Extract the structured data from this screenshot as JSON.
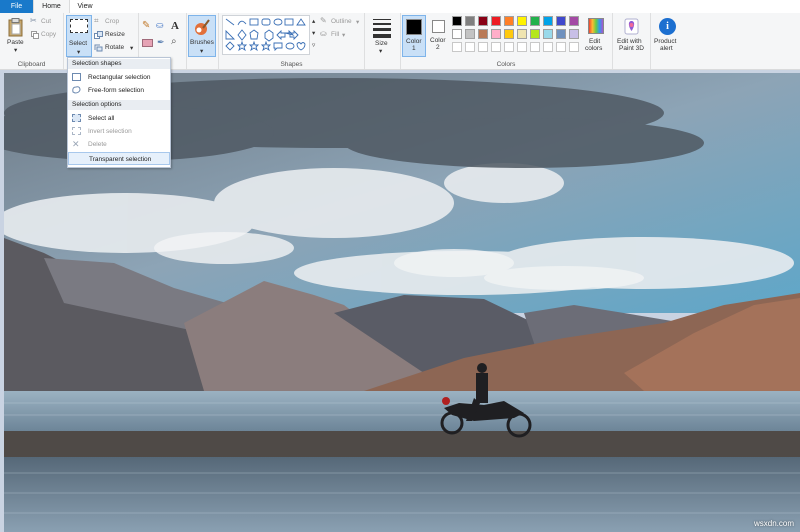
{
  "tabs": {
    "file": "File",
    "home": "Home",
    "view": "View"
  },
  "clipboard": {
    "paste": "Paste",
    "cut": "Cut",
    "copy": "Copy",
    "group": "Clipboard"
  },
  "image": {
    "select": "Select",
    "crop": "Crop",
    "resize": "Resize",
    "rotate": "Rotate"
  },
  "tools": {
    "text_icon_glyph": "A"
  },
  "brushes": {
    "label": "Brushes"
  },
  "shapes": {
    "group": "Shapes",
    "outline": "Outline",
    "fill": "Fill"
  },
  "size": {
    "label": "Size"
  },
  "colors": {
    "color1_line1": "Color",
    "color1_line2": "1",
    "color2_line1": "Color",
    "color2_line2": "2",
    "group": "Colors",
    "edit_line1": "Edit",
    "edit_line2": "colors",
    "color1_value": "#000000",
    "color2_value": "#ffffff",
    "palette_row1": [
      "#000000",
      "#7f7f7f",
      "#880015",
      "#ed1c24",
      "#ff7f27",
      "#fff200",
      "#22b14c",
      "#00a2e8",
      "#3f48cc",
      "#a349a4"
    ],
    "palette_row2": [
      "#ffffff",
      "#c3c3c3",
      "#b97a57",
      "#ffaec9",
      "#ffc90e",
      "#efe4b0",
      "#b5e61d",
      "#99d9ea",
      "#7092be",
      "#c8bfe7"
    ]
  },
  "paint3d": {
    "line1": "Edit with",
    "line2": "Paint 3D"
  },
  "alert": {
    "line1": "Product",
    "line2": "alert"
  },
  "select_menu": {
    "shapes_heading": "Selection shapes",
    "rectangular": "Rectangular selection",
    "freeform": "Free-form selection",
    "options_heading": "Selection options",
    "select_all": "Select all",
    "invert": "Invert selection",
    "delete": "Delete",
    "transparent": "Transparent selection"
  },
  "watermark": "wsxdn.com"
}
